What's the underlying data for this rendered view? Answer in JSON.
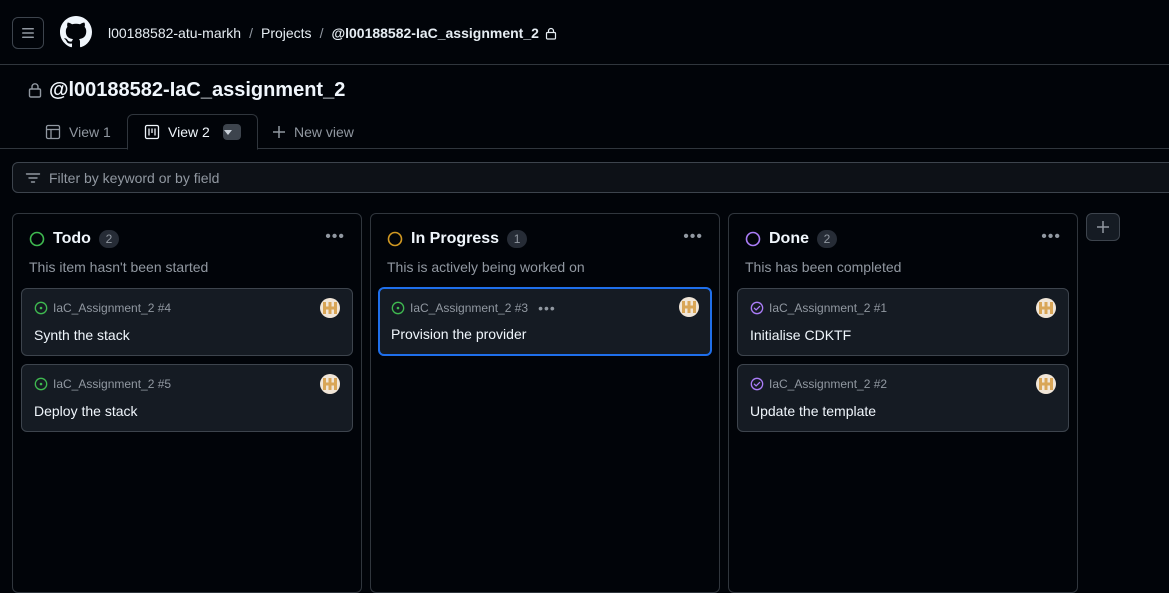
{
  "header": {
    "breadcrumbs": [
      "l00188582-atu-markh",
      "Projects",
      "@l00188582-IaC_assignment_2"
    ],
    "separator": "/"
  },
  "project": {
    "title": "@l00188582-IaC_assignment_2"
  },
  "tabs": [
    {
      "label": "View 1",
      "icon": "table-icon",
      "active": false
    },
    {
      "label": "View 2",
      "icon": "board-icon",
      "active": true
    },
    {
      "label": "New view",
      "icon": "plus-icon",
      "active": false
    }
  ],
  "filter": {
    "placeholder": "Filter by keyword or by field"
  },
  "columns": [
    {
      "name": "Todo",
      "count": "2",
      "description": "This item hasn't been started",
      "status_color": "#3fb950",
      "cards": [
        {
          "ref": "IaC_Assignment_2 #4",
          "title": "Synth the stack",
          "state": "open-issue-icon"
        },
        {
          "ref": "IaC_Assignment_2 #5",
          "title": "Deploy the stack",
          "state": "open-issue-icon"
        }
      ]
    },
    {
      "name": "In Progress",
      "count": "1",
      "description": "This is actively being worked on",
      "status_color": "#d29922",
      "cards": [
        {
          "ref": "IaC_Assignment_2 #3",
          "title": "Provision the provider",
          "state": "open-issue-icon",
          "selected": true
        }
      ]
    },
    {
      "name": "Done",
      "count": "2",
      "description": "This has been completed",
      "status_color": "#ab7df8",
      "cards": [
        {
          "ref": "IaC_Assignment_2 #1",
          "title": "Initialise CDKTF",
          "state": "closed-issue-icon"
        },
        {
          "ref": "IaC_Assignment_2 #2",
          "title": "Update the template",
          "state": "closed-issue-icon"
        }
      ]
    }
  ],
  "colors": {
    "open_issue": "#3fb950",
    "closed_issue": "#ab7df8",
    "selected_border": "#1f6feb",
    "background": "#010409"
  }
}
